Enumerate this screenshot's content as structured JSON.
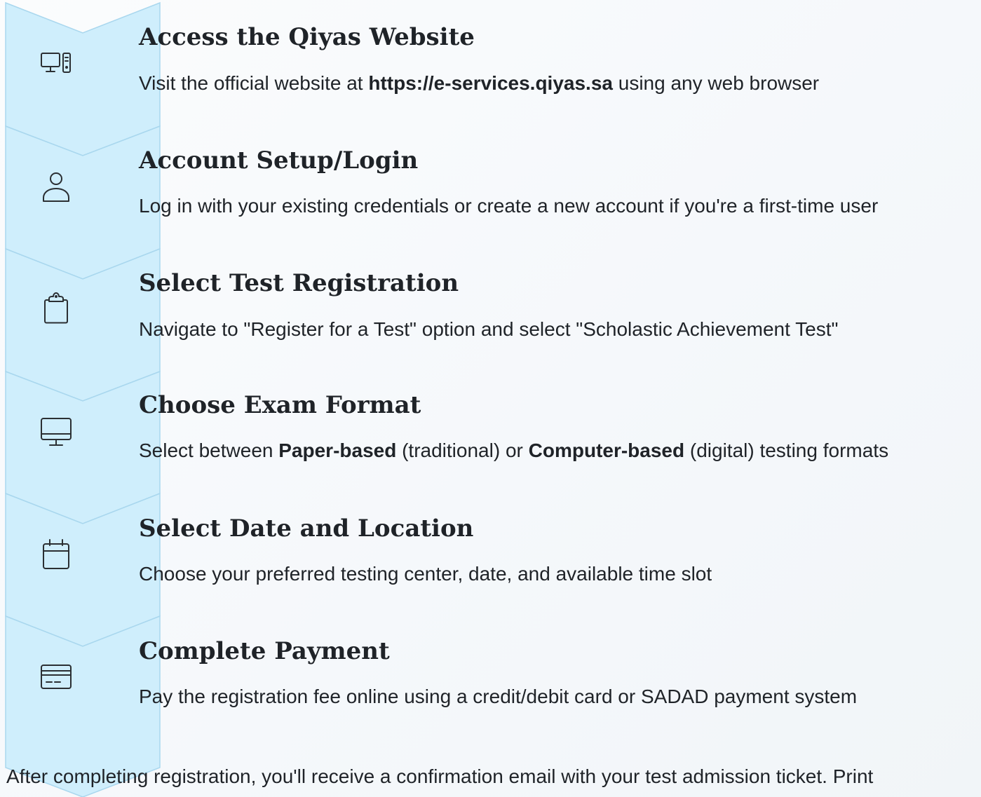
{
  "steps": [
    {
      "icon": "computer-tower-icon",
      "title": "Access the Qiyas Website",
      "desc_pre": "Visit the official website at ",
      "desc_bold": "https://e-services.qiyas.sa",
      "desc_post": " using any web browser"
    },
    {
      "icon": "user-icon",
      "title": "Account Setup/Login",
      "desc": "Log in with your existing credentials or create a new account if you're a first-time user"
    },
    {
      "icon": "clipboard-icon",
      "title": "Select Test Registration",
      "desc": "Navigate to \"Register for a Test\" option and select \"Scholastic Achievement Test\""
    },
    {
      "icon": "monitor-icon",
      "title": "Choose Exam Format",
      "desc_pre": "Select between ",
      "desc_bold1": "Paper-based",
      "desc_mid": " (traditional) or ",
      "desc_bold2": "Computer-based",
      "desc_post": " (digital) testing formats"
    },
    {
      "icon": "calendar-icon",
      "title": "Select Date and Location",
      "desc": "Choose your preferred testing center, date, and available time slot"
    },
    {
      "icon": "credit-card-icon",
      "title": "Complete Payment",
      "desc": "Pay the registration fee online using a credit/debit card or SADAD payment system"
    }
  ],
  "footer": "After completing registration, you'll receive a confirmation email with your test admission ticket. Print",
  "colors": {
    "chevron_fill": "#cfeefc",
    "chevron_stroke": "#a9d7ee",
    "icon_stroke": "#2b2f33"
  }
}
